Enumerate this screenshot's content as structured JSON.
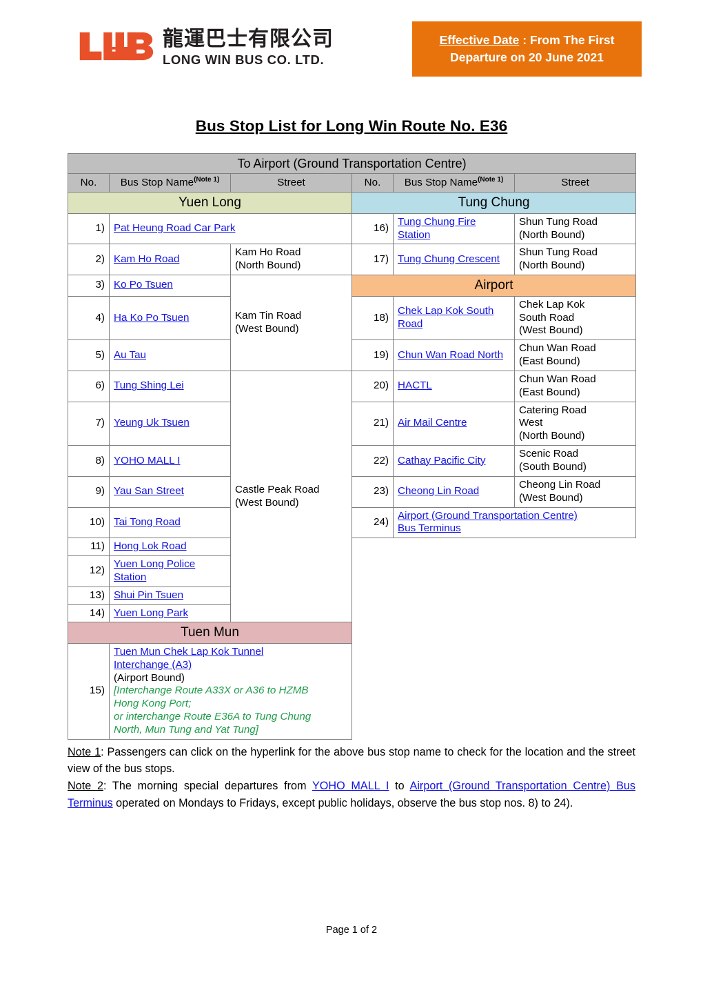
{
  "header": {
    "logo_cn": "龍運巴士有限公司",
    "logo_en": "LONG WIN BUS CO. LTD.",
    "logo_mark": "lwb-logo",
    "effective_label": "Effective Date",
    "effective_sep": " : ",
    "effective_line1_rest": "From The First",
    "effective_line2": "Departure on 20 June 2021",
    "banner_color": "#e8730c",
    "logo_color": "#e8502a"
  },
  "title": "Bus Stop List for Long Win Route No. E36",
  "table": {
    "main_header": "To Airport (Ground Transportation Centre)",
    "columns": {
      "no": "No.",
      "name": "Bus Stop Name",
      "name_note": "(Note 1)",
      "street": "Street"
    },
    "bands": {
      "yuen_long": "Yuen Long",
      "tung_chung": "Tung Chung",
      "airport": "Airport",
      "tuen_mun": "Tuen Mun"
    },
    "band_colors": {
      "yuen_long": "#dde3bd",
      "tung_chung": "#b6dde8",
      "airport": "#f9bd87",
      "tuen_mun": "#e2b6b8",
      "header_gray": "#bfbfbf"
    },
    "left_rows": [
      {
        "no": "1)",
        "name": "Pat Heung Road Car Park",
        "street": ""
      },
      {
        "no": "2)",
        "name": "Kam Ho Road",
        "street": "Kam Ho Road\n(North Bound)"
      },
      {
        "no": "3)",
        "name": "Ko Po Tsuen",
        "street": ""
      },
      {
        "no": "4)",
        "name": "Ha Ko Po Tsuen",
        "street": "Kam Tin Road\n(West Bound)"
      },
      {
        "no": "5)",
        "name": "Au Tau",
        "street": ""
      },
      {
        "no": "6)",
        "name": "Tung Shing Lei",
        "street": ""
      },
      {
        "no": "7)",
        "name": "Yeung Uk Tsuen",
        "street": ""
      },
      {
        "no": "8)",
        "name": "YOHO MALL I",
        "street": ""
      },
      {
        "no": "9)",
        "name": "Yau San Street",
        "street": "Castle Peak Road\n(West Bound)"
      },
      {
        "no": "10)",
        "name": "Tai Tong Road",
        "street": ""
      },
      {
        "no": "11)",
        "name": "Hong Lok Road",
        "street": ""
      },
      {
        "no": "12)",
        "name": "Yuen Long Police Station",
        "street": ""
      },
      {
        "no": "13)",
        "name": "Shui Pin Tsuen",
        "street": ""
      },
      {
        "no": "14)",
        "name": "Yuen Long Park",
        "street": ""
      }
    ],
    "tuen_mun_row": {
      "no": "15)",
      "link_line1": "Tuen Mun Chek Lap Kok Tunnel",
      "link_line2": "Interchange (A3)",
      "plain_line": "(Airport Bound)",
      "green_line1": "[Interchange Route A33X or A36 to HZMB",
      "green_line2": "Hong Kong Port;",
      "green_line3": "or interchange Route E36A to Tung Chung",
      "green_line4": "North, Mun Tung and Yat Tung]"
    },
    "right_rows": [
      {
        "no": "16)",
        "name": "Tung Chung Fire Station",
        "street": "Shun Tung Road\n(North Bound)"
      },
      {
        "no": "17)",
        "name": "Tung Chung Crescent",
        "street": "Shun Tung Road\n(North Bound)"
      },
      {
        "no": "18)",
        "name": "Chek Lap Kok South Road",
        "street": "Chek Lap Kok\nSouth Road\n(West Bound)"
      },
      {
        "no": "19)",
        "name": "Chun Wan Road North",
        "street": "Chun Wan Road\n(East Bound)"
      },
      {
        "no": "20)",
        "name": "HACTL",
        "street": "Chun Wan Road\n(East Bound)"
      },
      {
        "no": "21)",
        "name": "Air Mail Centre",
        "street": "Catering Road\nWest\n(North Bound)"
      },
      {
        "no": "22)",
        "name": "Cathay Pacific City",
        "street": "Scenic Road\n(South Bound)"
      },
      {
        "no": "23)",
        "name": "Cheong Lin Road",
        "street": "Cheong Lin Road\n(West Bound)"
      }
    ],
    "final_row": {
      "no": "24)",
      "name_line1": "Airport (Ground Transportation Centre)",
      "name_line2": "Bus Terminus"
    }
  },
  "notes": {
    "note1_label": "Note 1",
    "note1_text": ": Passengers can click on the hyperlink for the above bus stop name to check for the location and the street view of the bus stops.",
    "note2_label": "Note 2",
    "note2_part1": ": The morning special departures from ",
    "note2_link1": "YOHO MALL I",
    "note2_part2": " to ",
    "note2_link2": "Airport (Ground Transportation Centre) Bus Terminus",
    "note2_part3": " operated on Mondays to Fridays, except public holidays, observe the bus stop nos. 8) to 24)."
  },
  "footer": {
    "page_label": "Page 1 of 2"
  }
}
